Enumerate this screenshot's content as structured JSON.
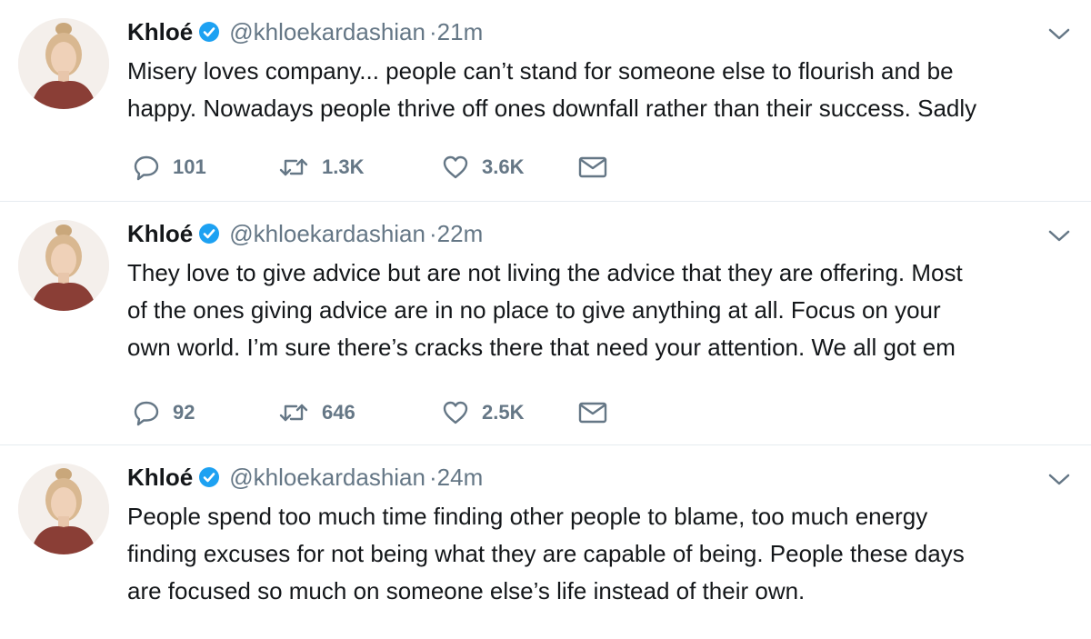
{
  "tweets": [
    {
      "name": "Khloé",
      "handle": "@khloekardashian",
      "separator": "·",
      "time": "21m",
      "text_lines": [
        "Misery loves company... people can’t stand for someone else to flourish and be",
        "happy. Nowadays people thrive off ones downfall rather than their success. Sadly"
      ],
      "replies": "101",
      "retweets": "1.3K",
      "likes": "3.6K"
    },
    {
      "name": "Khloé",
      "handle": "@khloekardashian",
      "separator": "·",
      "time": "22m",
      "text_lines": [
        "They love to give advice but are not living the advice that they are offering. Most",
        "of the ones giving advice are in no place to give anything at all. Focus on your",
        "own world. I’m sure there’s cracks there that need your attention. We all got em"
      ],
      "replies": "92",
      "retweets": "646",
      "likes": "2.5K"
    },
    {
      "name": "Khloé",
      "handle": "@khloekardashian",
      "separator": "·",
      "time": "24m",
      "text_lines": [
        "People spend too much time finding other people to blame, too much energy",
        "finding excuses for not being what they are capable of being. People these days",
        "are focused so much on someone else’s life instead of their own."
      ]
    }
  ],
  "icons": {
    "verified": "verified-badge-icon",
    "caret": "chevron-down-icon",
    "reply": "reply-icon",
    "retweet": "retweet-icon",
    "like": "heart-icon",
    "message": "envelope-icon"
  },
  "colors": {
    "text": "#14171a",
    "secondary": "#657786",
    "verified": "#1da1f2",
    "divider": "#e6ecf0"
  }
}
